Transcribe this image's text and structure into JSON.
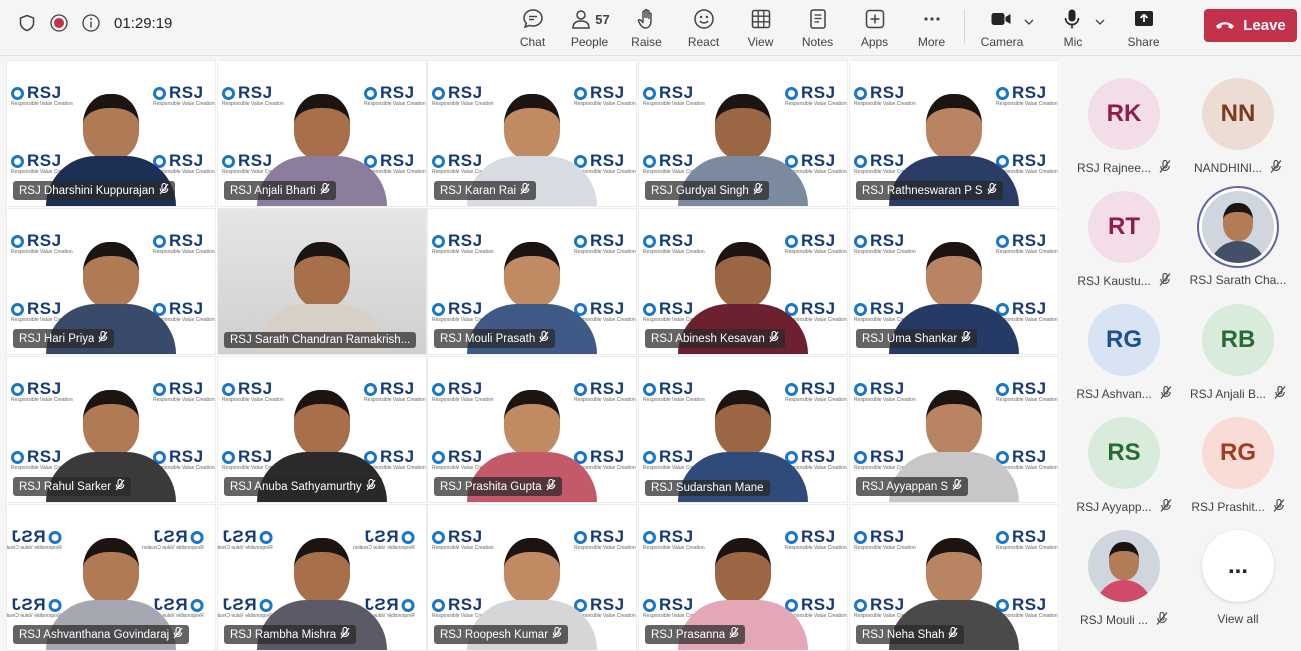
{
  "status": {
    "timer": "01:29:19"
  },
  "toolbar": {
    "chat": "Chat",
    "people": "People",
    "people_count": "57",
    "raise": "Raise",
    "react": "React",
    "view": "View",
    "notes": "Notes",
    "apps": "Apps",
    "more": "More",
    "camera": "Camera",
    "mic": "Mic",
    "share": "Share",
    "leave": "Leave"
  },
  "colors": {
    "leave": "#c4314b",
    "accent": "#6264a7",
    "logo": "#153a7a"
  },
  "tiles": [
    {
      "name": "RSJ  Dharshini Kuppurajan"
    },
    {
      "name": "RSJ Anjali Bharti"
    },
    {
      "name": "RSJ Karan Rai"
    },
    {
      "name": "RSJ Gurdyal Singh"
    },
    {
      "name": "RSJ Rathneswaran P S"
    },
    {
      "name": "RSJ Hari Priya"
    },
    {
      "name": "RSJ Sarath Chandran Ramakrish..."
    },
    {
      "name": "RSJ Mouli Prasath"
    },
    {
      "name": "RSJ Abinesh Kesavan"
    },
    {
      "name": "RSJ Uma Shankar"
    },
    {
      "name": "RSJ Rahul Sarker"
    },
    {
      "name": "RSJ Anuba Sathyamurthy"
    },
    {
      "name": "RSJ Prashita Gupta"
    },
    {
      "name": "RSJ Sudarshan Mane"
    },
    {
      "name": "RSJ Ayyappan S"
    },
    {
      "name": "RSJ Ashvanthana Govindaraj"
    },
    {
      "name": "RSJ Rambha Mishra"
    },
    {
      "name": "RSJ Roopesh Kumar"
    },
    {
      "name": "RSJ Prasanna"
    },
    {
      "name": "RSJ Neha Shah"
    }
  ],
  "logo_text": "RSJ",
  "logo_tagline": "Responsible Value Creation",
  "sidebar": [
    {
      "initials": "RK",
      "label": "RSJ Rajnee...",
      "muted": true,
      "bg": "#f3dde8",
      "fg": "#8e1c4e"
    },
    {
      "initials": "NN",
      "label": "NANDHINI...",
      "muted": true,
      "bg": "#ecdcd3",
      "fg": "#7a3b20"
    },
    {
      "initials": "RT",
      "label": "RSJ Kaustu...",
      "muted": true,
      "bg": "#f3dde8",
      "fg": "#8e1c4e"
    },
    {
      "initials": "",
      "label": "RSJ Sarath Cha...",
      "muted": false,
      "photo": true
    },
    {
      "initials": "RG",
      "label": "RSJ Ashvan...",
      "muted": true,
      "bg": "#d8e4f4",
      "fg": "#1e4f91"
    },
    {
      "initials": "RB",
      "label": "RSJ Anjali B...",
      "muted": true,
      "bg": "#d9ecdc",
      "fg": "#2a6a36"
    },
    {
      "initials": "RS",
      "label": "RSJ Ayyapp...",
      "muted": true,
      "bg": "#d9ecdc",
      "fg": "#2a6a36"
    },
    {
      "initials": "RG",
      "label": "RSJ Prashit...",
      "muted": true,
      "bg": "#f9dcd6",
      "fg": "#a33a22"
    },
    {
      "initials": "",
      "label": "RSJ Mouli ...",
      "muted": true,
      "photo": true
    },
    {
      "initials": "...",
      "label": "View all",
      "muted": false,
      "viewall": true
    }
  ]
}
